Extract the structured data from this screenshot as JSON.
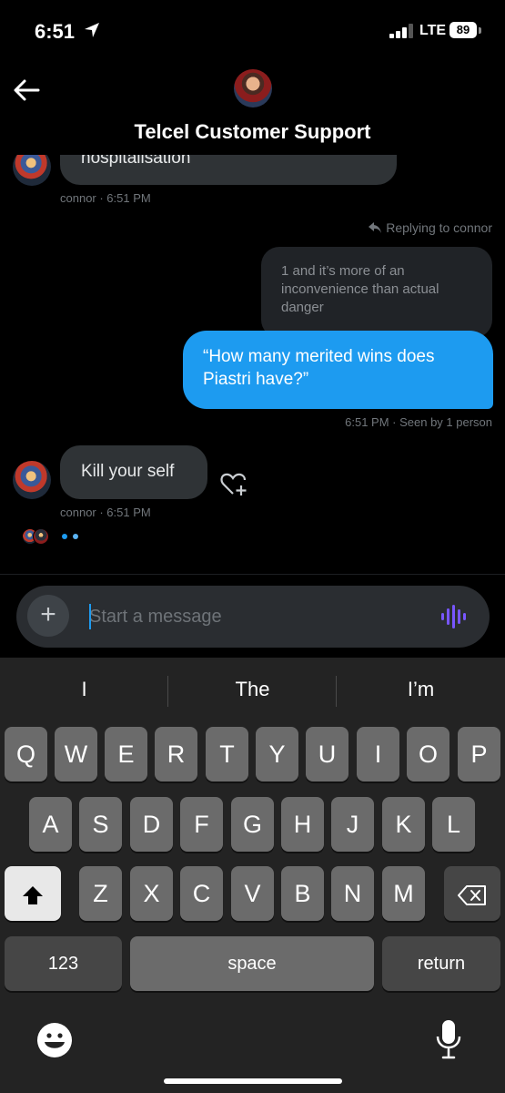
{
  "status": {
    "time": "6:51",
    "network": "LTE",
    "battery": "89"
  },
  "header": {
    "title": "Telcel Customer Support"
  },
  "messages": {
    "prev_text": "hospitalisation",
    "prev_meta": "connor · 6:51 PM",
    "replying_label": "Replying to connor",
    "quoted_text": "1 and it’s more of an inconvenience than actual danger",
    "sent_text": "“How many merited wins does Piastri have?”",
    "sent_meta": "6:51 PM · Seen by 1 person",
    "received_text": "Kill your self",
    "received_meta": "connor · 6:51 PM"
  },
  "composer": {
    "placeholder": "Start a message",
    "plus_label": "+"
  },
  "keyboard": {
    "suggestions": [
      "I",
      "The",
      "I’m"
    ],
    "row1": [
      "Q",
      "W",
      "E",
      "R",
      "T",
      "Y",
      "U",
      "I",
      "O",
      "P"
    ],
    "row2": [
      "A",
      "S",
      "D",
      "F",
      "G",
      "H",
      "J",
      "K",
      "L"
    ],
    "row3": [
      "Z",
      "X",
      "C",
      "V",
      "B",
      "N",
      "M"
    ],
    "numbers_label": "123",
    "space_label": "space",
    "return_label": "return",
    "backspace_icon": "delete-left-icon",
    "shift_icon": "shift-icon"
  },
  "colors": {
    "accent": "#1d9bf0",
    "incoming_bubble": "#2f3336",
    "voice": "#7856ff"
  }
}
